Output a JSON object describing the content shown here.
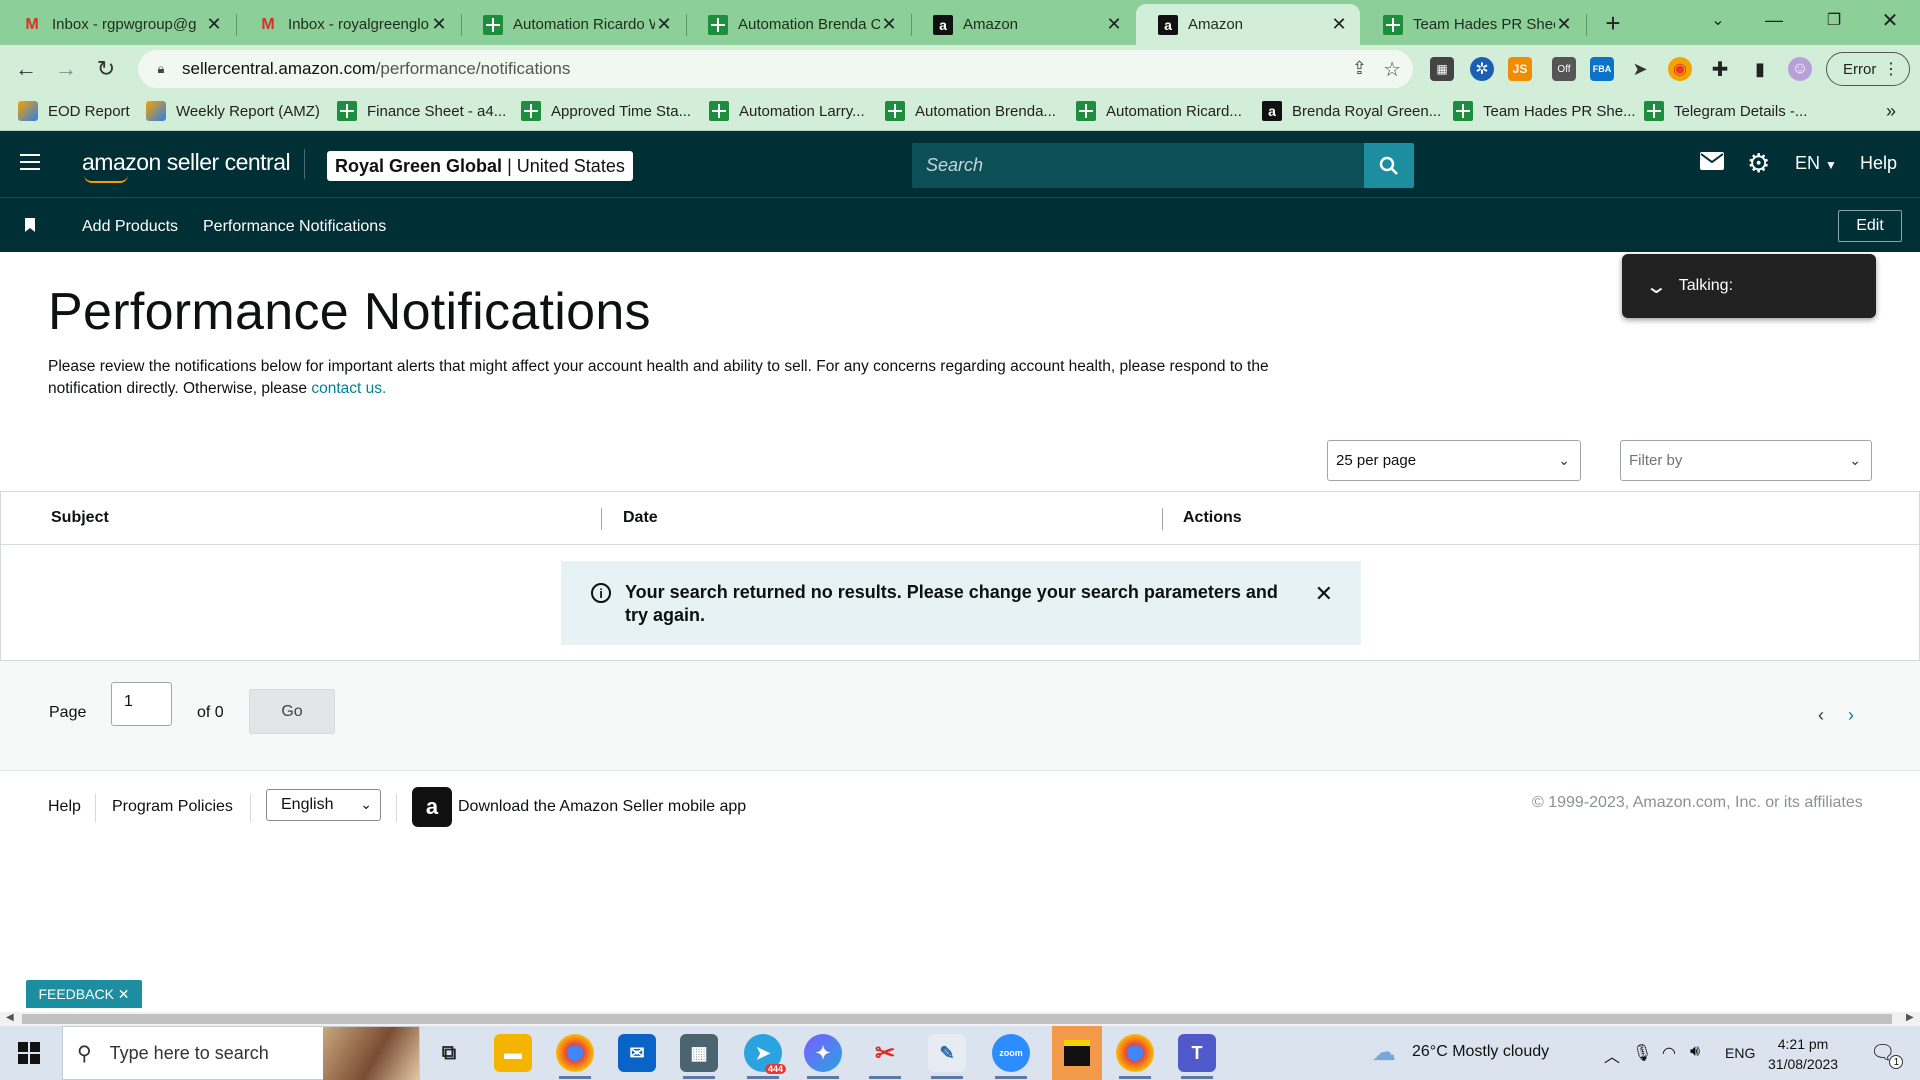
{
  "browser": {
    "tabs": [
      {
        "label": "Inbox - rgpwgroup@g",
        "icon": "gmail-icon"
      },
      {
        "label": "Inbox - royalgreenglo",
        "icon": "gmail-icon"
      },
      {
        "label": "Automation Ricardo W",
        "icon": "sheets-icon"
      },
      {
        "label": "Automation Brenda C",
        "icon": "sheets-icon"
      },
      {
        "label": "Amazon",
        "icon": "amazon-icon"
      },
      {
        "label": "Amazon",
        "icon": "amazon-icon",
        "active": true
      },
      {
        "label": "Team Hades PR Sheet",
        "icon": "sheets-icon"
      }
    ],
    "url_domain": "sellercentral.amazon.com",
    "url_path": "/performance/notifications",
    "profile_label": "Error",
    "ext_js": "JS",
    "ext_off": "Off",
    "ext_fba": "FBA",
    "bookmarks": [
      {
        "label": "EOD Report"
      },
      {
        "label": "Weekly Report (AMZ)"
      },
      {
        "label": "Finance Sheet - a4..."
      },
      {
        "label": "Approved Time Sta..."
      },
      {
        "label": "Automation Larry..."
      },
      {
        "label": "Automation Brenda..."
      },
      {
        "label": "Automation Ricard..."
      },
      {
        "label": "Brenda Royal Green..."
      },
      {
        "label": "Team Hades PR She..."
      },
      {
        "label": "Telegram Details -..."
      }
    ],
    "bookmarks_overflow": "»"
  },
  "header": {
    "logo_text": "amazon seller central",
    "account_name": "Royal Green Global",
    "account_sep": "|",
    "account_region": "United States",
    "search_placeholder": "Search",
    "language": "EN",
    "help": "Help"
  },
  "subnav": {
    "items": [
      "Add Products",
      "Performance Notifications"
    ],
    "edit_label": "Edit"
  },
  "main": {
    "title": "Performance Notifications",
    "description": "Please review the notifications below for important alerts that might affect your account health and ability to sell. For any concerns regarding account health, please respond to the notification directly. Otherwise, please ",
    "contact_link": "contact us.",
    "per_page": "25 per page",
    "filter_placeholder": "Filter by",
    "columns": [
      "Subject",
      "Date",
      "Actions"
    ],
    "alert_message": "Your search returned no results. Please change your search parameters and try again."
  },
  "pagination": {
    "page_label": "Page",
    "page_value": "1",
    "of_label": "of 0",
    "go_label": "Go"
  },
  "footer": {
    "help": "Help",
    "program_policies": "Program Policies",
    "language": "English",
    "app_link": "Download the Amazon Seller mobile app",
    "copyright": "© 1999-2023, Amazon.com, Inc. or its affiliates"
  },
  "feedback_label": "FEEDBACK ✕",
  "talking_label": "Talking:",
  "taskbar": {
    "search_placeholder": "Type here to search",
    "telegram_badge": "444",
    "zoom_label": "zoom",
    "weather": "26°C  Mostly cloudy",
    "lang": "ENG",
    "time": "4:21 pm",
    "date": "31/08/2023",
    "notifications": "1"
  },
  "colors": {
    "tab_strip": "#8ccf98",
    "header_bg": "#002f36",
    "search_button": "#1d8ea0",
    "link": "#008296",
    "alert_bg": "#e6f2f3"
  }
}
